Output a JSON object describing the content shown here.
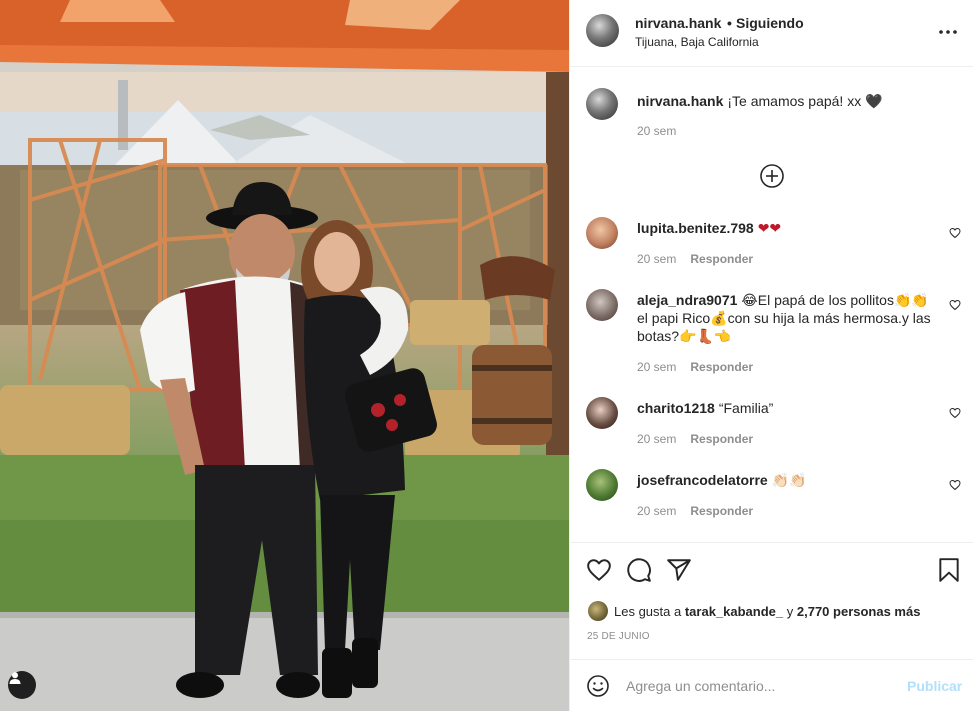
{
  "post": {
    "author": "nirvana.hank",
    "separator": "•",
    "follow_status": "Siguiendo",
    "location": "Tijuana, Baja California",
    "more_icon": "more-options-icon"
  },
  "caption": {
    "author": "nirvana.hank",
    "text": "¡Te amamos papá! xx 🖤",
    "time": "20 sem"
  },
  "load_more_icon": "plus-circle-icon",
  "comments": [
    {
      "author": "lupita.benitez.798",
      "text": "❤❤",
      "time": "20 sem",
      "reply": "Responder"
    },
    {
      "author": "aleja_ndra9071",
      "text": "😂El papá de los pollitos👏👏el papi Rico💰con su hija la más hermosa.y las botas?👉👢👈",
      "time": "20 sem",
      "reply": "Responder"
    },
    {
      "author": "charito1218",
      "text": "“Familia”",
      "time": "20 sem",
      "reply": "Responder"
    },
    {
      "author": "josefrancodelatorre",
      "text": "👏🏻👏🏻",
      "time": "20 sem",
      "reply": "Responder"
    }
  ],
  "likes": {
    "prefix": "Les gusta a",
    "user": "tarak_kabande_",
    "middle": "y",
    "count_text": "2,770 personas más"
  },
  "date": "25 DE JUNIO",
  "add_comment": {
    "placeholder": "Agrega un comentario...",
    "submit": "Publicar"
  },
  "colors": {
    "accent_link": "#b2dffc",
    "secondary_text": "#8e8e8e",
    "heart_red": "#c0182b"
  }
}
